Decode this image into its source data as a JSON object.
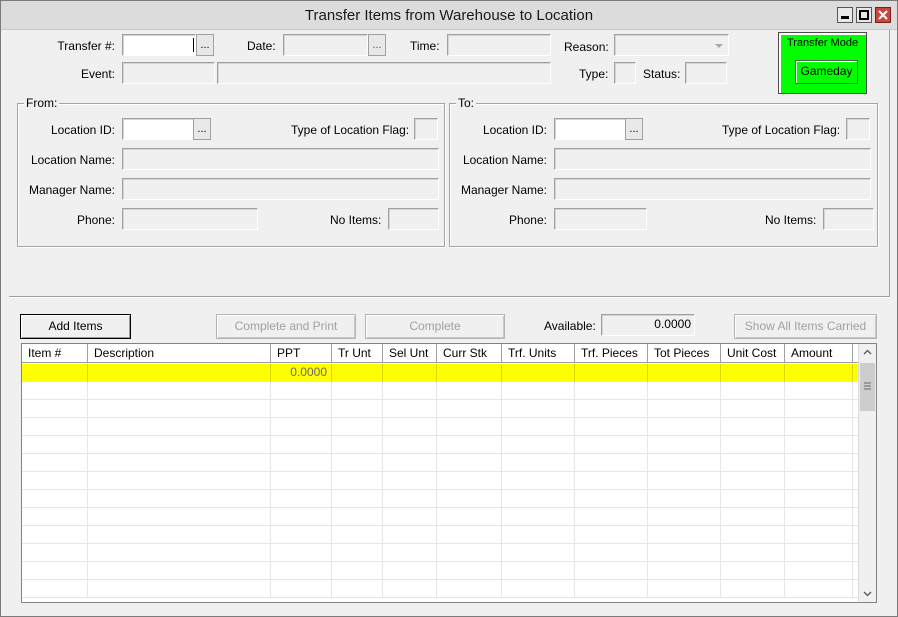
{
  "window": {
    "title": "Transfer Items from Warehouse to Location"
  },
  "header": {
    "transfer_label": "Transfer #:",
    "transfer_value": "",
    "date_label": "Date:",
    "date_value": "",
    "time_label": "Time:",
    "time_value": "",
    "reason_label": "Reason:",
    "reason_value": "",
    "event_label": "Event:",
    "event_code": "",
    "event_name": "",
    "type_label": "Type:",
    "type_value": "",
    "status_label": "Status:",
    "status_value": "",
    "ellipsis": "...",
    "transfer_mode_title": "Transfer Mode",
    "transfer_mode_value": "Gameday",
    "transfer_mode_color": "#00ff00"
  },
  "from": {
    "title": "From:",
    "location_id_label": "Location ID:",
    "location_id_value": "",
    "flag_label": "Type of Location Flag:",
    "location_name_label": "Location Name:",
    "manager_name_label": "Manager Name:",
    "phone_label": "Phone:",
    "no_items_label": "No Items:"
  },
  "to": {
    "title": "To:",
    "location_id_label": "Location ID:",
    "location_id_value": "",
    "flag_label": "Type of Location Flag:",
    "location_name_label": "Location Name:",
    "manager_name_label": "Manager Name:",
    "phone_label": "Phone:",
    "no_items_label": "No Items:"
  },
  "toolbar": {
    "add_items": "Add Items",
    "complete_and_print": "Complete and Print",
    "complete": "Complete",
    "available_label": "Available:",
    "available_value": "0.0000",
    "show_all_items": "Show All Items Carried"
  },
  "grid": {
    "columns": [
      "Item #",
      "Description",
      "PPT",
      "Tr Unt",
      "Sel Unt",
      "Curr Stk",
      "Trf. Units",
      "Trf. Pieces",
      "Tot Pieces",
      "Unit Cost",
      "Amount"
    ],
    "rows": [
      {
        "ppt": "0.0000"
      }
    ],
    "selected_row_color": "#ffff00"
  }
}
